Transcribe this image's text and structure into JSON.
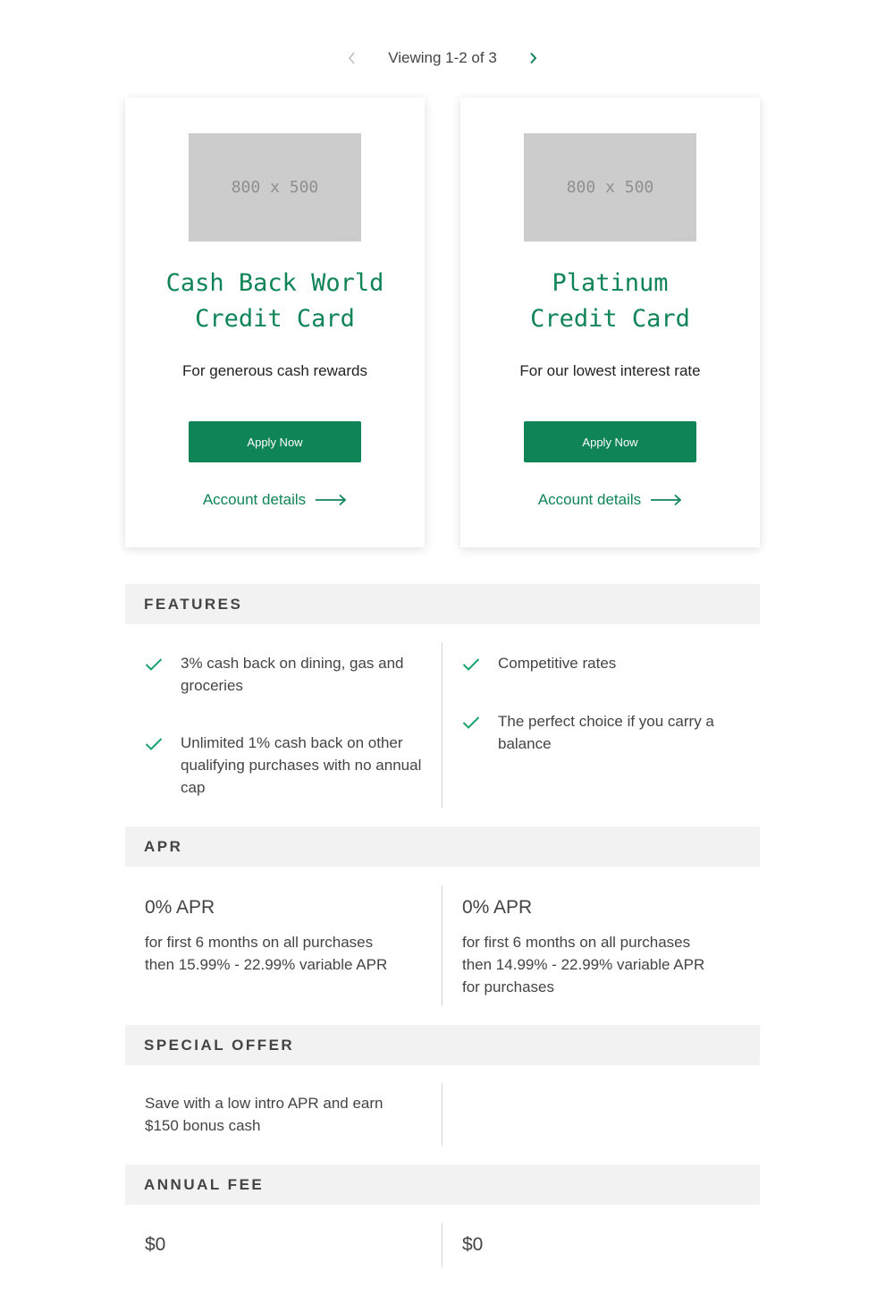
{
  "pager": {
    "label": "Viewing 1-2 of 3"
  },
  "cards": [
    {
      "image_text": "800 x 500",
      "title_line1": "Cash Back World",
      "title_line2": "Credit Card",
      "subtitle": "For generous cash rewards",
      "apply_label": "Apply Now",
      "details_label": "Account details"
    },
    {
      "image_text": "800 x 500",
      "title_line1": "Platinum",
      "title_line2": "Credit Card",
      "subtitle": "For our lowest interest rate",
      "apply_label": "Apply Now",
      "details_label": "Account details"
    }
  ],
  "sections": {
    "features": "FEATURES",
    "apr": "APR",
    "special_offer": "SPECIAL OFFER",
    "annual_fee": "ANNUAL FEE"
  },
  "features": {
    "left": [
      "3% cash back on dining, gas and groceries",
      "Unlimited 1% cash back on other qualifying purchases with no annual cap"
    ],
    "right": [
      "Competitive rates",
      "The perfect choice if you carry a balance"
    ]
  },
  "apr": {
    "left": {
      "value": "0% APR",
      "line1": "for first 6 months on all purchases",
      "line2": "then 15.99% - 22.99% variable APR"
    },
    "right": {
      "value": "0% APR",
      "line1": "for first 6 months on all purchases",
      "line2": "then 14.99% - 22.99% variable APR",
      "line3": "for purchases"
    }
  },
  "special_offer": {
    "left": "Save with a low intro APR and earn $150 bonus cash"
  },
  "annual_fee": {
    "left": "$0",
    "right": "$0"
  },
  "colors": {
    "brand_green": "#0f8457",
    "check_green": "#1aa36e",
    "section_bg": "#f2f2f2"
  }
}
